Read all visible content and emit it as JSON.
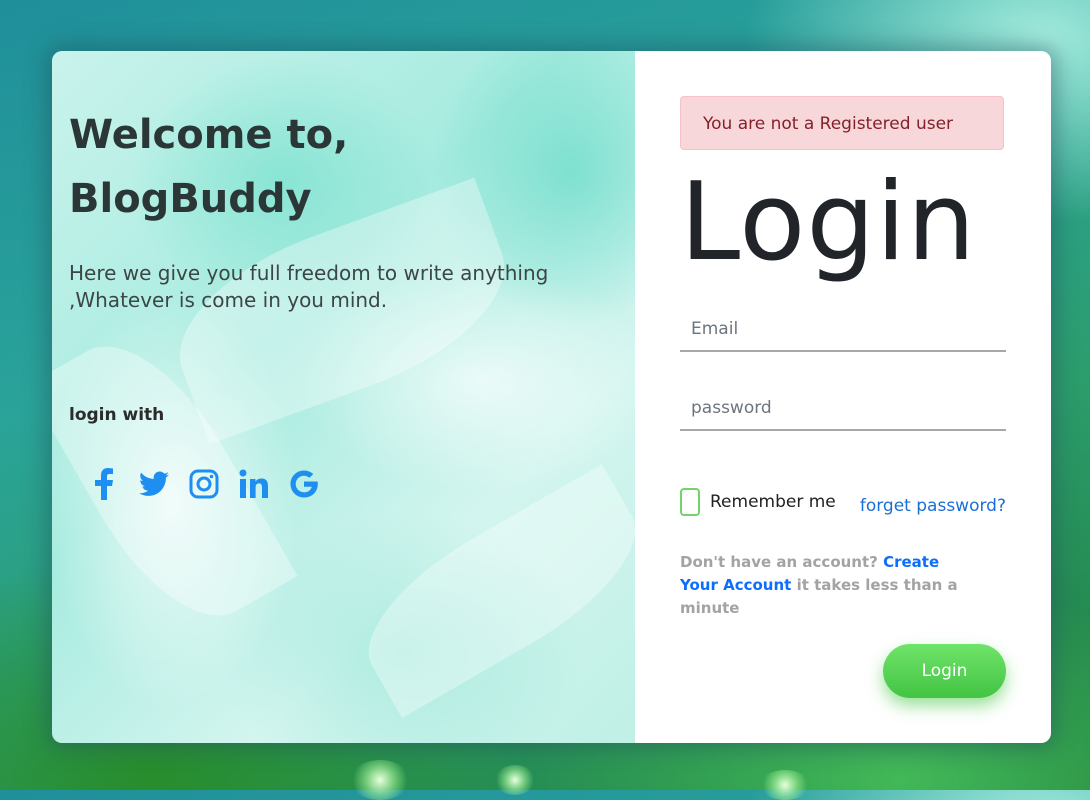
{
  "welcome": {
    "line1": "Welcome to,",
    "line2": "BlogBuddy",
    "tagline": "Here we give you full freedom to write anything ,Whatever is come in you mind.",
    "login_with": "login with"
  },
  "socials": [
    {
      "icon": "facebook-icon"
    },
    {
      "icon": "twitter-icon"
    },
    {
      "icon": "instagram-icon"
    },
    {
      "icon": "linkedin-icon"
    },
    {
      "icon": "google-icon"
    }
  ],
  "alert": {
    "text": "You are not a Registered user"
  },
  "form": {
    "title": "Login",
    "email_placeholder": "Email",
    "email_value": "",
    "password_placeholder": "password",
    "password_value": "",
    "remember_label": "Remember me",
    "remember_checked": false,
    "forgot_label": "forget password?",
    "signup_prefix": "Don't have an account?",
    "signup_link": "Create Your Account",
    "signup_suffix": "it takes less than a minute",
    "login_button": "Login"
  },
  "colors": {
    "accent_green": "#43c443",
    "link_blue": "#0d6efd",
    "social_blue": "#1e8ff0",
    "alert_bg": "#f8d7da",
    "alert_text": "#842029"
  }
}
